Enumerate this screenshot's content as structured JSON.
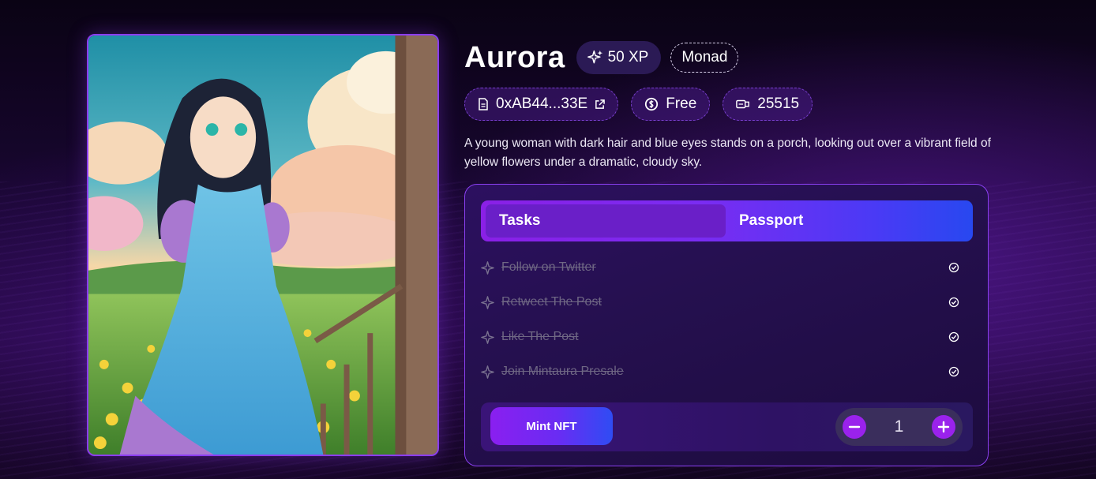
{
  "nft": {
    "name": "Aurora",
    "xp": "50 XP",
    "chain": "Monad",
    "contract": "0xAB44...33E",
    "price": "Free",
    "supply": "25515",
    "description": "A young woman with dark hair and blue eyes stands on a porch, looking out over a vibrant field of yellow flowers under a dramatic, cloudy sky.",
    "image_icon": "anime-girl-artwork"
  },
  "tabs": [
    {
      "label": "Tasks",
      "active": true
    },
    {
      "label": "Passport",
      "active": false
    }
  ],
  "tasks": [
    {
      "label": "Follow on Twitter",
      "completed": true
    },
    {
      "label": "Retweet The Post",
      "completed": true
    },
    {
      "label": "Like The Post",
      "completed": true
    },
    {
      "label": "Join Mintaura Presale",
      "completed": true
    }
  ],
  "mint": {
    "button_label": "Mint NFT",
    "quantity": "1"
  },
  "colors": {
    "accent_purple": "#8a3ff0",
    "accent_blue": "#2848f0",
    "panel_bg": "#25104f",
    "completed_task_text": "#6f6784"
  }
}
